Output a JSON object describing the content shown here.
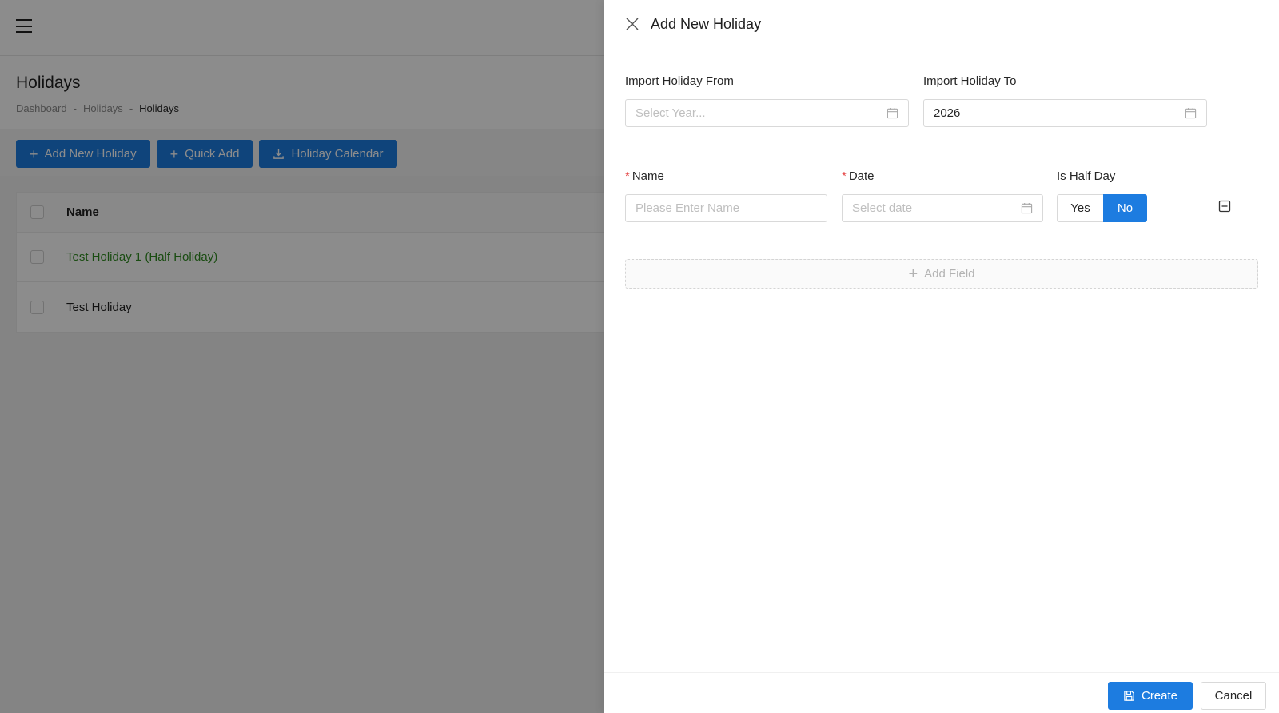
{
  "page": {
    "title": "Holidays",
    "breadcrumb": [
      "Dashboard",
      "-",
      "Holidays",
      "-",
      "Holidays"
    ],
    "toolbar": {
      "add_new_label": "Add New Holiday",
      "quick_add_label": "Quick Add",
      "calendar_label": "Holiday Calendar"
    },
    "table": {
      "column_name": "Name",
      "rows": [
        {
          "name": "Test Holiday 1 (Half Holiday)",
          "half": true
        },
        {
          "name": "Test Holiday",
          "half": false
        }
      ]
    }
  },
  "drawer": {
    "title": "Add New Holiday",
    "import_from": {
      "label": "Import Holiday From",
      "placeholder": "Select Year..."
    },
    "import_to": {
      "label": "Import Holiday To",
      "value": "2026"
    },
    "name": {
      "label": "Name",
      "placeholder": "Please Enter Name"
    },
    "date": {
      "label": "Date",
      "placeholder": "Select date"
    },
    "half_day": {
      "label": "Is Half Day",
      "yes": "Yes",
      "no": "No",
      "selected": "No"
    },
    "add_field_label": "Add Field",
    "create_label": "Create",
    "cancel_label": "Cancel"
  },
  "colors": {
    "primary": "#1d7ce0",
    "half_holiday_text": "#2e8b1f",
    "required": "#e54848"
  }
}
